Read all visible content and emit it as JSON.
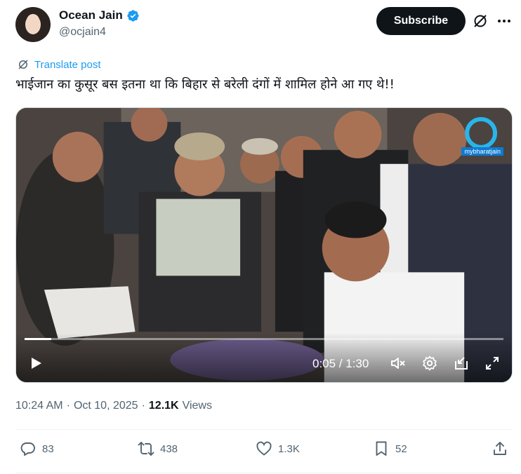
{
  "author": {
    "display_name": "Ocean Jain",
    "handle": "@ocjain4",
    "verified": true,
    "verified_color": "#1d9bf0"
  },
  "header": {
    "subscribe_label": "Subscribe",
    "grok_icon": "grok-icon",
    "more_icon": "more-icon"
  },
  "post": {
    "translate_label": "Translate post",
    "text": "भाईजान का कुसूर बस इतना था कि बिहार से बरेली दंगों में शामिल होने आ गए थे!!"
  },
  "video": {
    "time_display": "0:05 / 1:30",
    "progress_fraction": 0.056,
    "watermark": "mybharatjain"
  },
  "meta": {
    "time": "10:24 AM",
    "separator": "·",
    "date": "Oct 10, 2025",
    "views_count": "12.1K",
    "views_label": "Views"
  },
  "actions": {
    "replies": "83",
    "reposts": "438",
    "likes": "1.3K",
    "bookmarks": "52"
  },
  "colors": {
    "accent": "#1d9bf0",
    "text_primary": "#0f1419",
    "text_secondary": "#536471"
  }
}
